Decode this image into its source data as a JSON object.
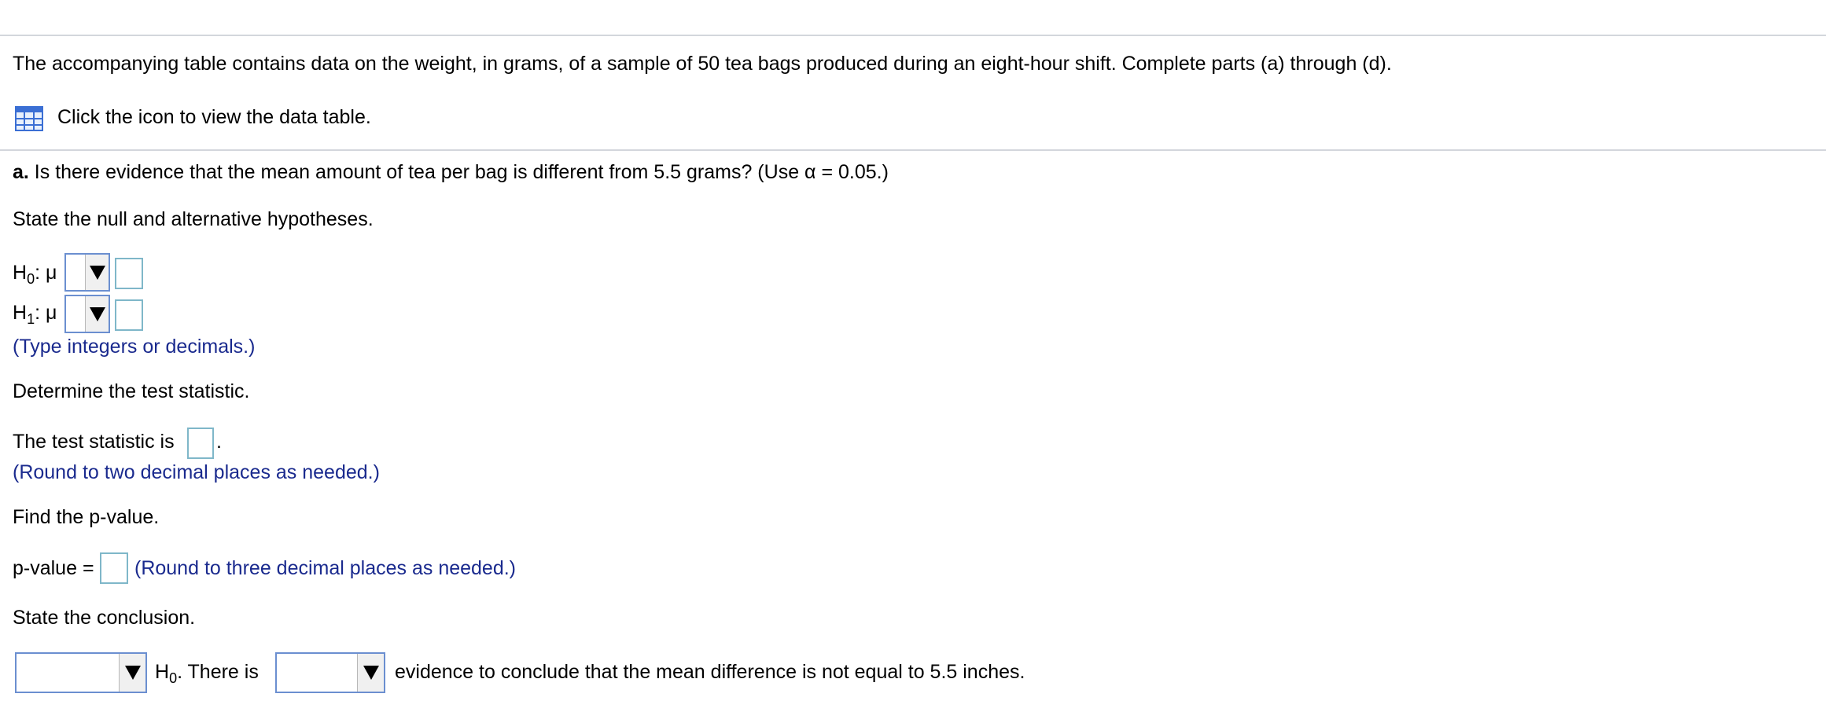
{
  "intro": {
    "text": "The accompanying table contains data on the weight, in grams, of a sample of 50 tea bags produced during an eight-hour shift. Complete parts (a) through (d).",
    "table_link": "Click the icon to view the data table."
  },
  "part_a": {
    "label": "a.",
    "question": " Is there evidence that the mean amount of tea per bag is different from 5.5 grams? (Use α = 0.05.)",
    "hypotheses_prompt": "State the null and alternative hypotheses.",
    "h0": {
      "h": "H",
      "sub": "0",
      "rest": ": μ"
    },
    "h1": {
      "h": "H",
      "sub": "1",
      "rest": ": μ"
    },
    "hypotheses_hint": "(Type integers or decimals.)",
    "test_stat_prompt": "Determine the test statistic.",
    "test_stat_prefix": "The test statistic is",
    "test_stat_suffix": ".",
    "test_stat_hint": "(Round to two decimal places as needed.)",
    "pvalue_prompt": "Find the p-value.",
    "pvalue_prefix": "p-value =",
    "pvalue_hint": "(Round to three decimal places as needed.)",
    "conclusion_prompt": "State the conclusion.",
    "conclusion": {
      "h": "H",
      "sub": "0",
      "mid": ". There is",
      "end": "evidence to conclude that the mean difference is not equal to 5.5 inches."
    }
  },
  "colors": {
    "hint": "#1a2a8e",
    "dropdown_border": "#6b8fd0",
    "input_border": "#7fb7c9",
    "rule": "#d3d6dc",
    "icon": "#3b6fd4"
  },
  "icons": {
    "table": "table-grid-icon",
    "dropdown": "dropdown-triangle-icon"
  }
}
